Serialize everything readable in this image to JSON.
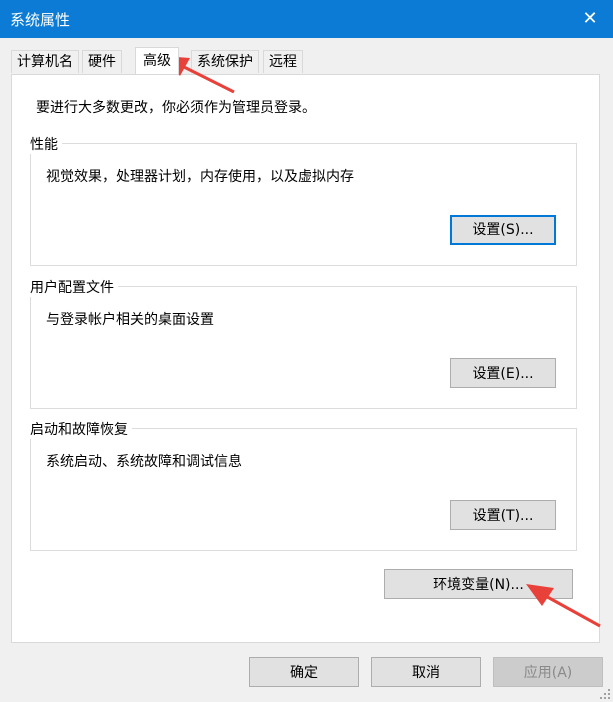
{
  "window": {
    "title": "系统属性",
    "close_label": "✕"
  },
  "tabs": [
    {
      "label": "计算机名",
      "active": false
    },
    {
      "label": "硬件",
      "active": false
    },
    {
      "label": "高级",
      "active": true
    },
    {
      "label": "系统保护",
      "active": false
    },
    {
      "label": "远程",
      "active": false
    }
  ],
  "panel": {
    "admin_note": "要进行大多数更改，你必须作为管理员登录。",
    "performance": {
      "title": "性能",
      "description": "视觉效果，处理器计划，内存使用，以及虚拟内存",
      "button": "设置(S)..."
    },
    "user_profiles": {
      "title": "用户配置文件",
      "description": "与登录帐户相关的桌面设置",
      "button": "设置(E)..."
    },
    "startup_recovery": {
      "title": "启动和故障恢复",
      "description": "系统启动、系统故障和调试信息",
      "button": "设置(T)..."
    },
    "env_button": "环境变量(N)..."
  },
  "footer": {
    "ok": "确定",
    "cancel": "取消",
    "apply": "应用(A)"
  },
  "colors": {
    "titlebar": "#0b7bd6",
    "annotation_arrow": "#e8413a",
    "focus": "#0078d7"
  }
}
